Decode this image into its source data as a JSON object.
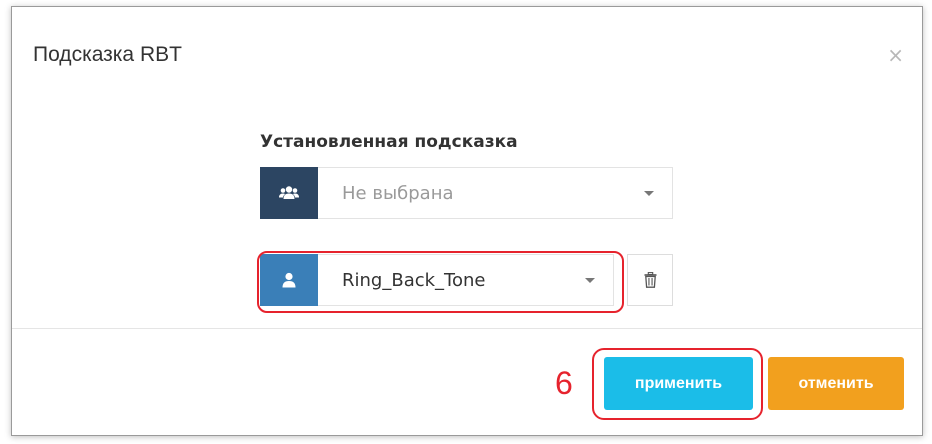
{
  "dialog": {
    "title": "Подсказка RBT",
    "close_symbol": "×"
  },
  "form": {
    "section_label": "Установленная подсказка",
    "group_select": {
      "icon": "users-icon",
      "value": "Не выбрана"
    },
    "user_select": {
      "icon": "user-icon",
      "value": "Ring_Back_Tone"
    },
    "delete_icon": "trash-icon"
  },
  "annotation": {
    "step_number": "6"
  },
  "footer": {
    "apply_label": "применить",
    "cancel_label": "отменить"
  },
  "colors": {
    "addon_dark": "#2c4562",
    "addon_blue": "#3a7fb8",
    "apply": "#1bbde8",
    "cancel": "#f2a01e",
    "highlight": "#e6232d"
  }
}
